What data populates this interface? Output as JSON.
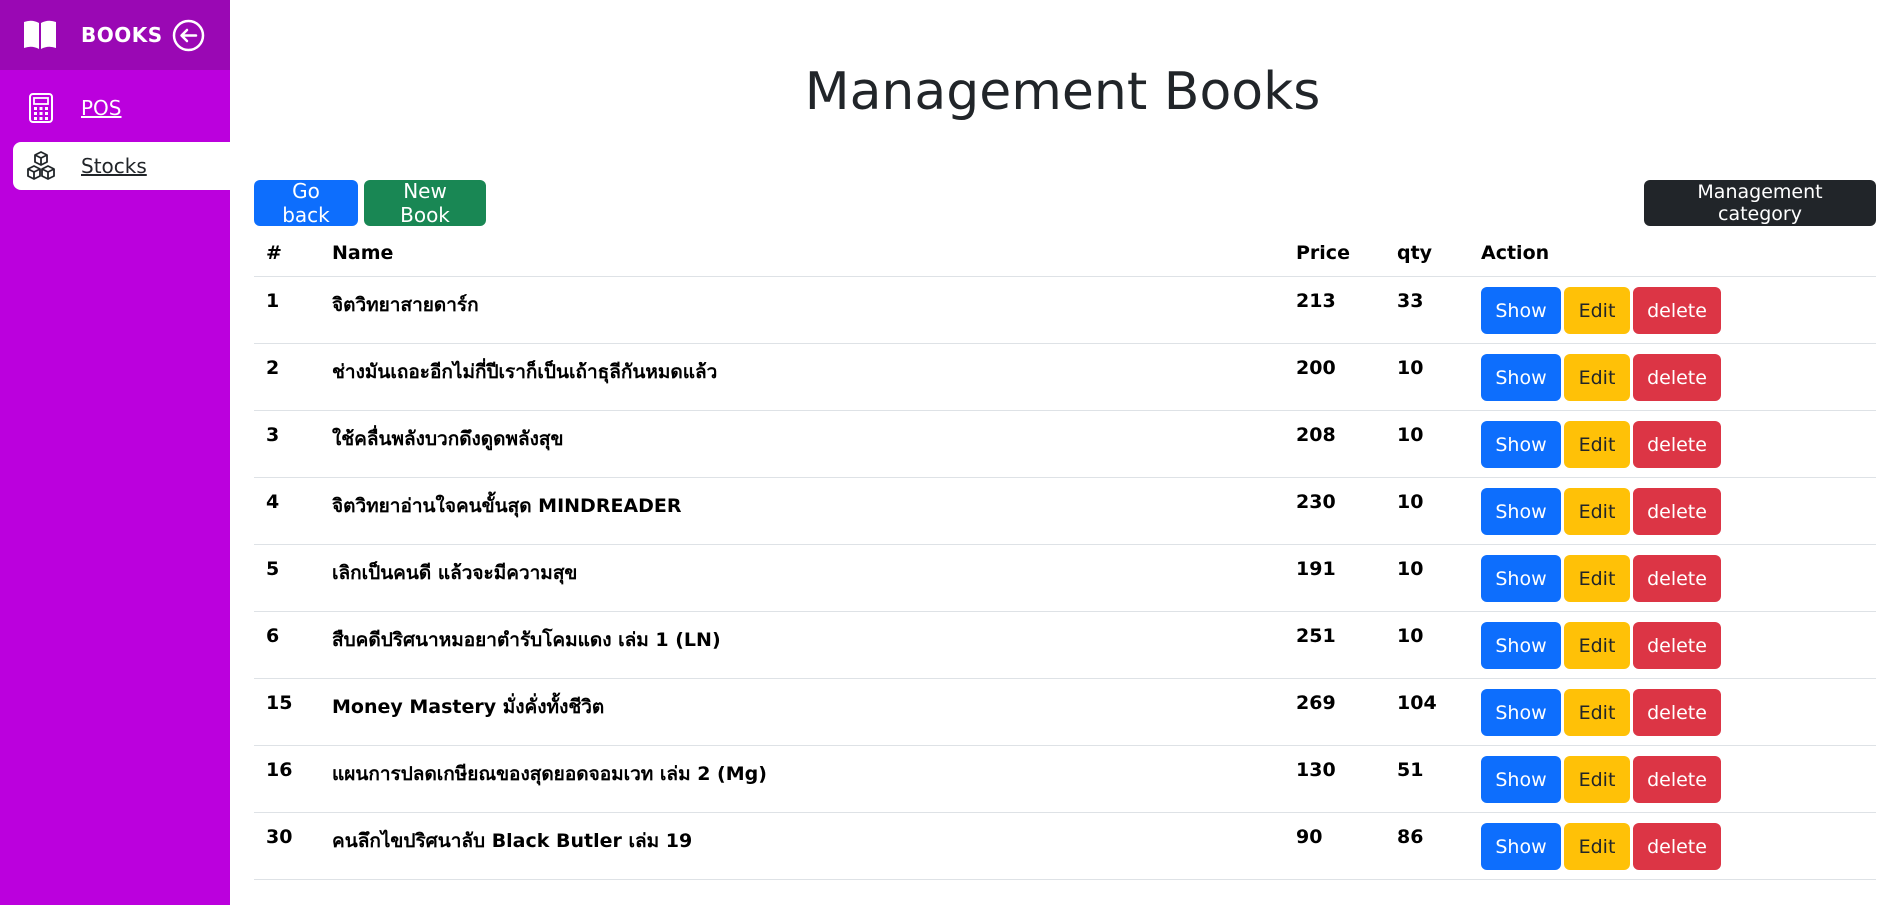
{
  "sidebar": {
    "brand": "BOOKS",
    "items": [
      {
        "label": "POS",
        "icon": "calculator-icon"
      },
      {
        "label": "Stocks",
        "icon": "boxes-icon"
      }
    ]
  },
  "page": {
    "title": "Management Books"
  },
  "toolbar": {
    "go_back": "Go back",
    "new_book": "New Book",
    "management_category": "Management category"
  },
  "table": {
    "headers": [
      "#",
      "Name",
      "Price",
      "qty",
      "Action"
    ],
    "rows": [
      {
        "id": "1",
        "name": "จิตวิทยาสายดาร์ก",
        "price": "213",
        "qty": "33"
      },
      {
        "id": "2",
        "name": "ช่างมันเถอะอีกไม่กี่ปีเราก็เป็นเถ้าธุลีกันหมดแล้ว",
        "price": "200",
        "qty": "10"
      },
      {
        "id": "3",
        "name": "ใช้คลื่นพลังบวกดึงดูดพลังสุข",
        "price": "208",
        "qty": "10"
      },
      {
        "id": "4",
        "name": "จิตวิทยาอ่านใจคนขั้นสุด MINDREADER",
        "price": "230",
        "qty": "10"
      },
      {
        "id": "5",
        "name": "เลิกเป็นคนดี แล้วจะมีความสุข",
        "price": "191",
        "qty": "10"
      },
      {
        "id": "6",
        "name": "สืบคดีปริศนาหมอยาตำรับโคมแดง เล่ม 1 (LN)",
        "price": "251",
        "qty": "10"
      },
      {
        "id": "15",
        "name": "Money Mastery มั่งคั่งทั้งชีวิต",
        "price": "269",
        "qty": "104"
      },
      {
        "id": "16",
        "name": "แผนการปลดเกษียณของสุดยอดจอมเวท เล่ม 2 (Mg)",
        "price": "130",
        "qty": "51"
      },
      {
        "id": "30",
        "name": "คนลึกไขปริศนาลับ Black Butler เล่ม 19",
        "price": "90",
        "qty": "86"
      }
    ],
    "actions": {
      "show": "Show",
      "edit": "Edit",
      "delete": "delete"
    }
  },
  "colors": {
    "sidebar": "#bb00dd",
    "brand_bar": "#9a08b4",
    "primary": "#0d6efd",
    "success": "#198754",
    "warning": "#ffc107",
    "danger": "#dc3545",
    "dark": "#212529"
  }
}
